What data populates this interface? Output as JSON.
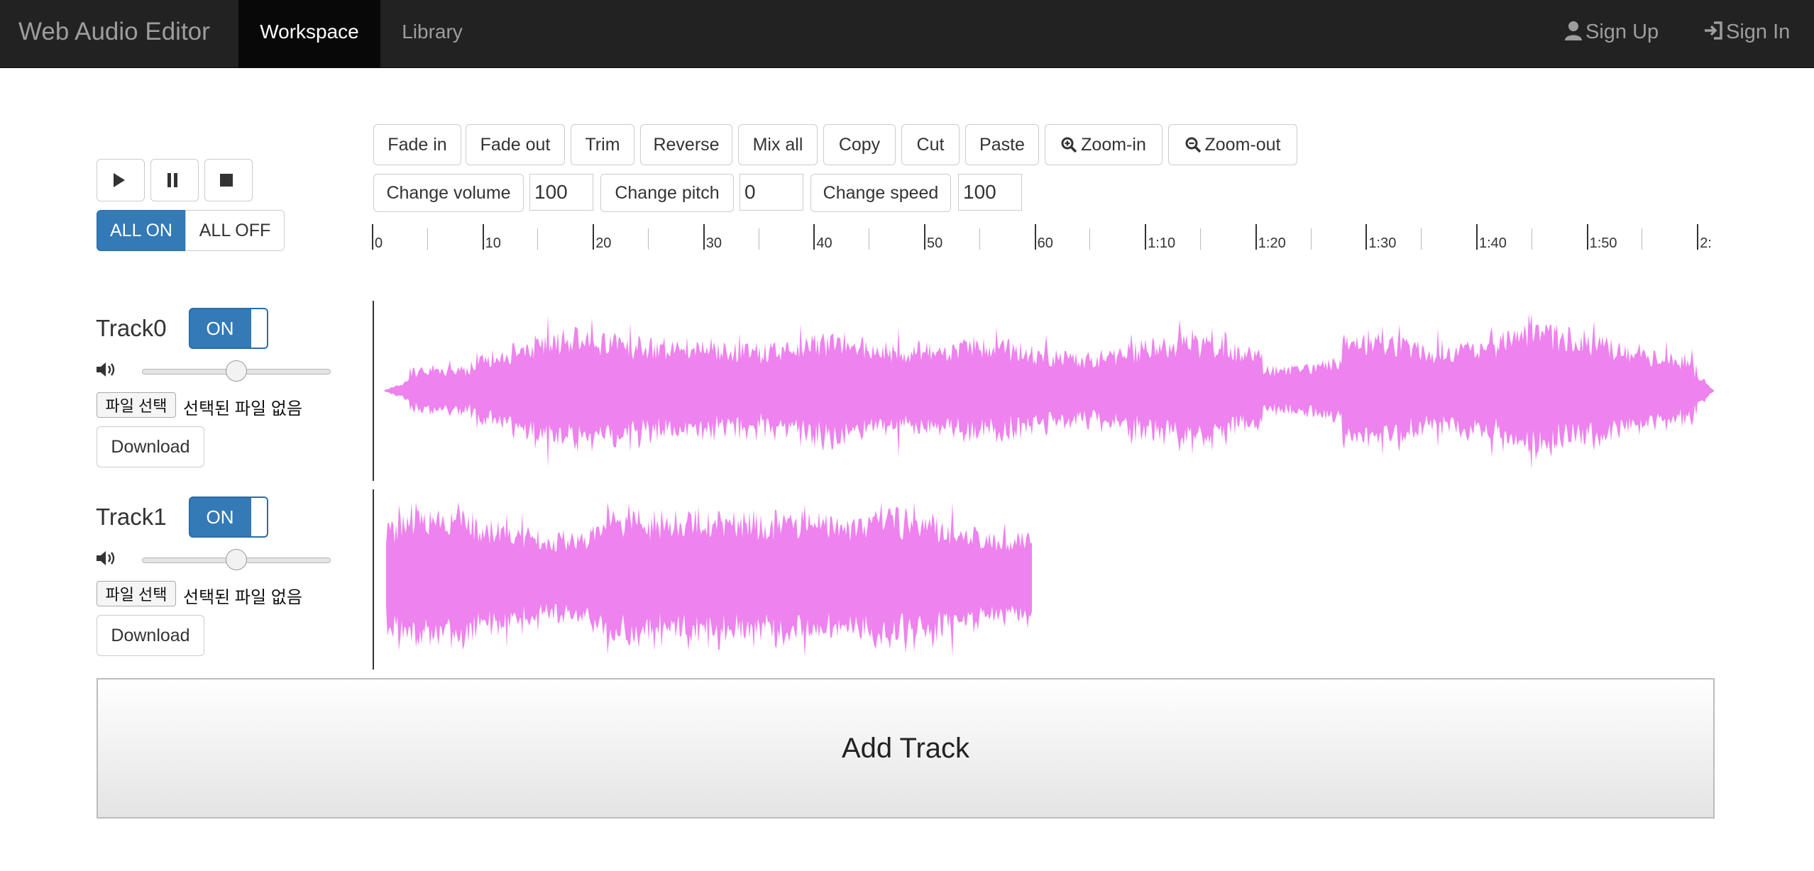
{
  "navbar": {
    "brand": "Web Audio Editor",
    "tabs": [
      {
        "label": "Workspace",
        "active": true
      },
      {
        "label": "Library",
        "active": false
      }
    ],
    "sign_up": "Sign Up",
    "sign_in": "Sign In",
    "sign_up_icon": "user-icon",
    "sign_in_icon": "log-in-icon"
  },
  "playback": {
    "play_icon": "play-icon",
    "pause_icon": "pause-icon",
    "stop_icon": "stop-icon",
    "all_on": "ALL ON",
    "all_off": "ALL OFF"
  },
  "toolbar": {
    "fade_in": "Fade in",
    "fade_out": "Fade out",
    "trim": "Trim",
    "reverse": "Reverse",
    "mix_all": "Mix all",
    "copy": "Copy",
    "cut": "Cut",
    "paste": "Paste",
    "zoom_in": "Zoom-in",
    "zoom_out": "Zoom-out",
    "change_volume": "Change volume",
    "volume_value": "100",
    "change_pitch": "Change pitch",
    "pitch_value": "0",
    "change_speed": "Change speed",
    "speed_value": "100"
  },
  "timeline": {
    "labels": [
      "0",
      "10",
      "20",
      "30",
      "40",
      "50",
      "60",
      "1:10",
      "1:20",
      "1:30",
      "1:40",
      "1:50",
      "2:"
    ]
  },
  "tracks": [
    {
      "name": "Track0",
      "toggle": "ON",
      "file_button": "파일 선택",
      "file_status": "선택된 파일 없음",
      "download": "Download",
      "volume_level": 0.5
    },
    {
      "name": "Track1",
      "toggle": "ON",
      "file_button": "파일 선택",
      "file_status": "선택된 파일 없음",
      "download": "Download",
      "volume_level": 0.5
    }
  ],
  "add_track": "Add Track",
  "colors": {
    "navbar_bg": "#222222",
    "primary": "#337ab7",
    "waveform": "#ee82ee"
  }
}
